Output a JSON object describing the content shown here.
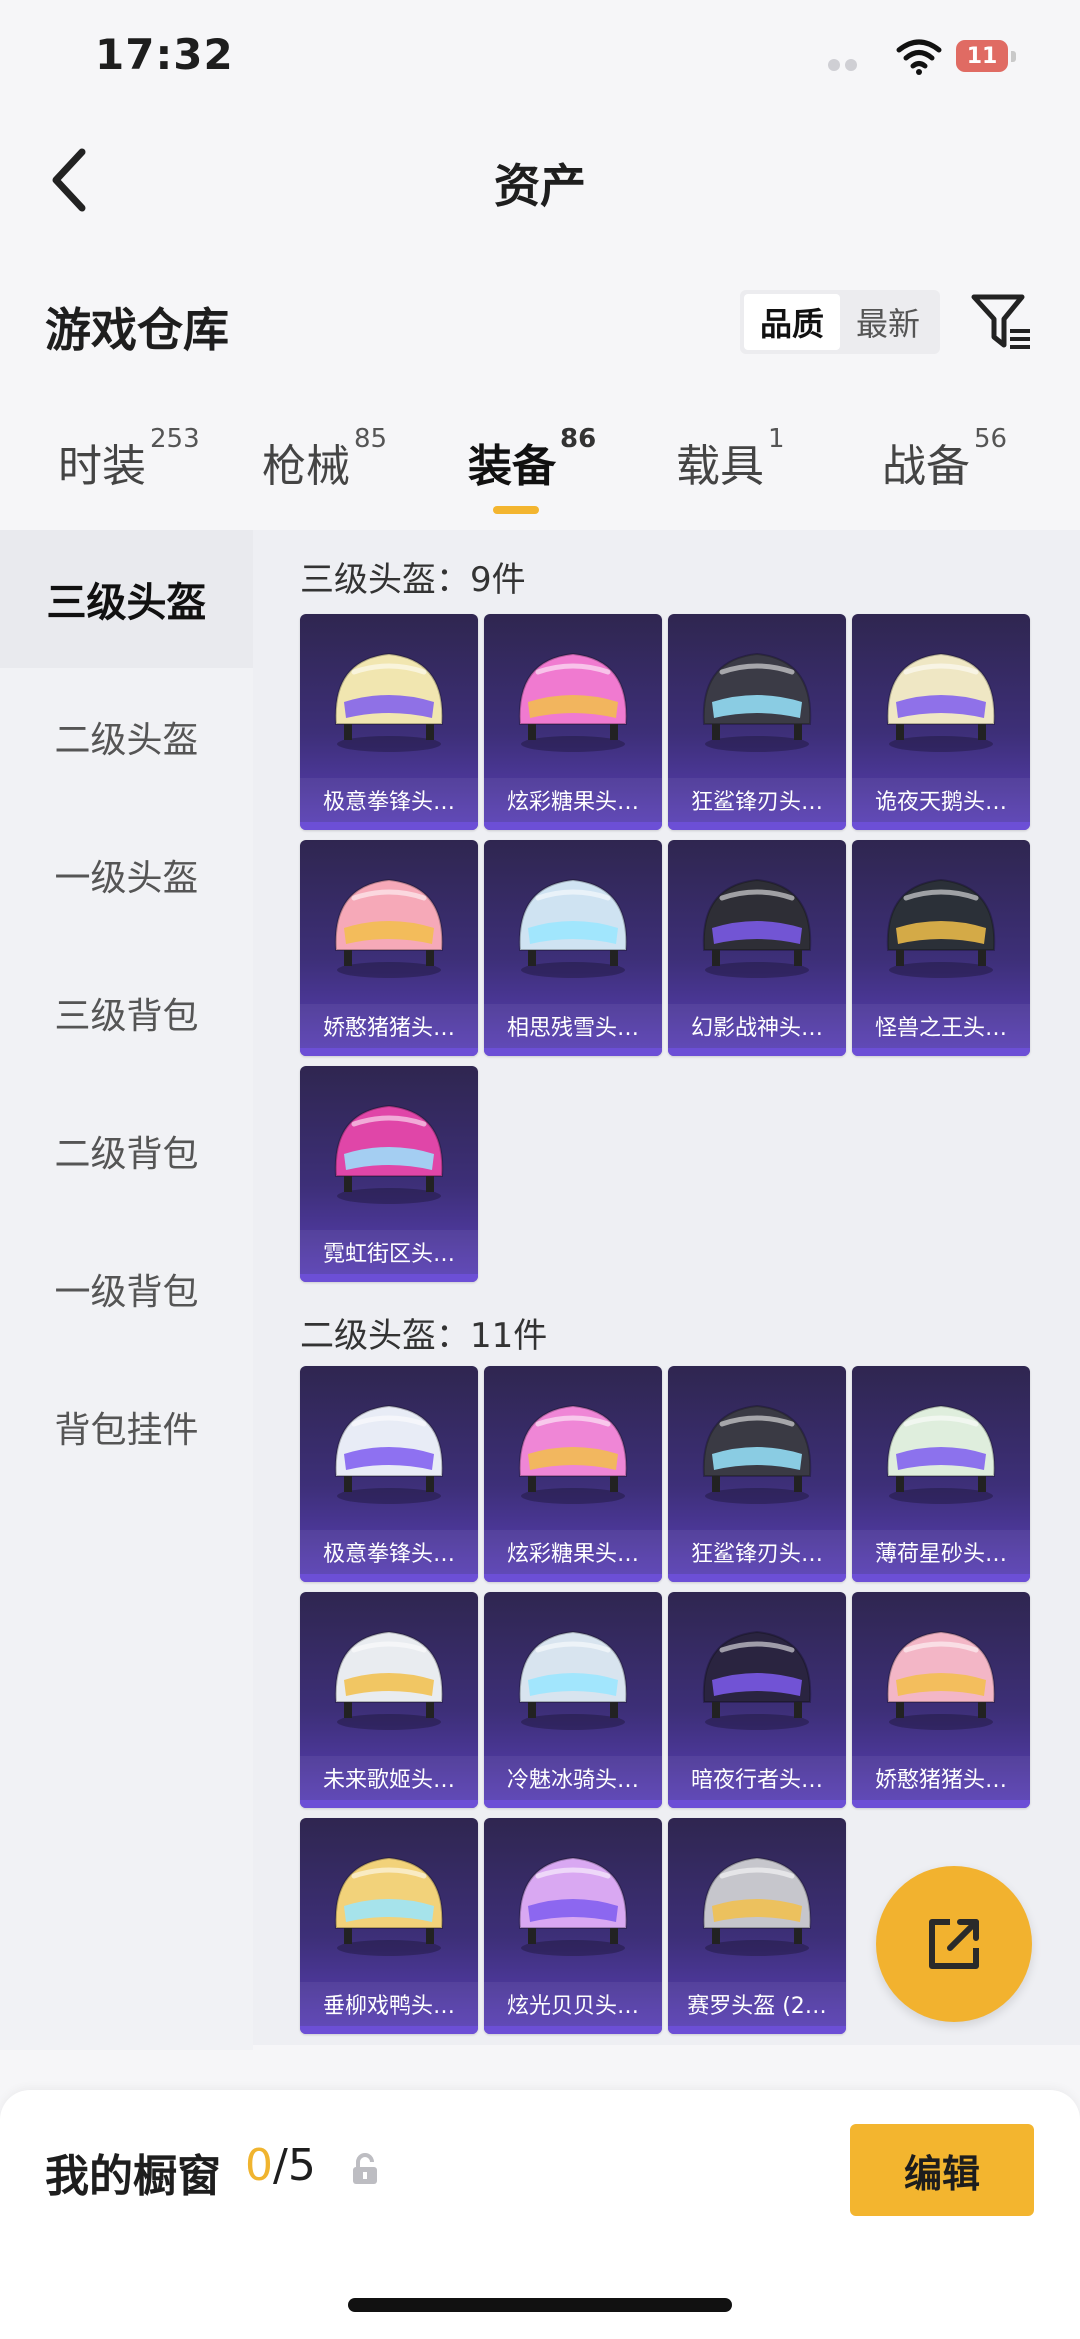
{
  "status": {
    "time": "17:32",
    "battery": "11"
  },
  "nav": {
    "title": "资产"
  },
  "warehouse": {
    "title": "游戏仓库"
  },
  "sort": {
    "options": [
      "品质",
      "最新"
    ],
    "active": "品质"
  },
  "category_tabs": [
    {
      "label": "时装",
      "count": "253"
    },
    {
      "label": "枪械",
      "count": "85"
    },
    {
      "label": "装备",
      "count": "86"
    },
    {
      "label": "载具",
      "count": "1"
    },
    {
      "label": "战备",
      "count": "56"
    }
  ],
  "sidebar": {
    "items": [
      "三级头盔",
      "二级头盔",
      "一级头盔",
      "三级背包",
      "二级背包",
      "一级背包",
      "背包挂件"
    ]
  },
  "sections": [
    {
      "title": "三级头盔：9件",
      "items": [
        "极意拳锋头…",
        "炫彩糖果头…",
        "狂鲨锋刃头…",
        "诡夜天鹅头…",
        "娇憨猪猪头…",
        "相思残雪头…",
        "幻影战神头…",
        "怪兽之王头…",
        "霓虹街区头…"
      ]
    },
    {
      "title": "二级头盔：11件",
      "items": [
        "极意拳锋头…",
        "炫彩糖果头…",
        "狂鲨锋刃头…",
        "薄荷星砂头…",
        "未来歌姬头…",
        "冷魅冰骑头…",
        "暗夜行者头…",
        "娇憨猪猪头…",
        "垂柳戏鸭头…",
        "炫光贝贝头…",
        "赛罗头盔 (2…"
      ]
    }
  ],
  "showcase": {
    "label": "我的橱窗",
    "current": "0",
    "total": "/5",
    "edit_label": "编辑"
  },
  "colors": {
    "accent": "#f3b52f",
    "card_bg": "#3d2f78"
  }
}
